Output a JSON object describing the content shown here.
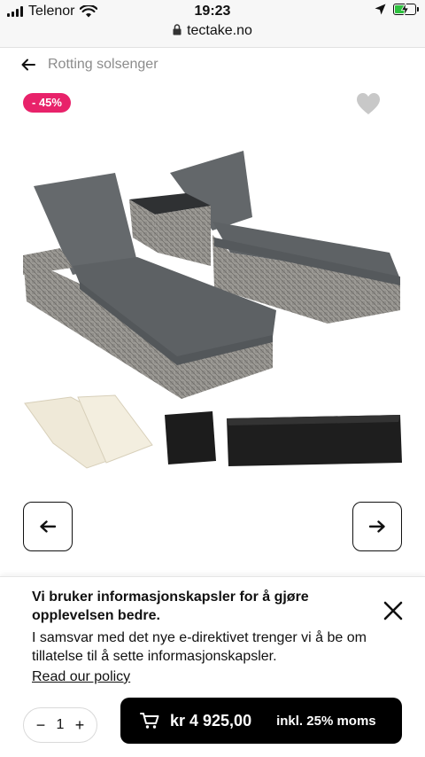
{
  "status_bar": {
    "carrier": "Telenor",
    "time": "19:23",
    "url": "tectake.no"
  },
  "breadcrumb": {
    "label": "Rotting solsenger"
  },
  "product": {
    "discount_badge": "- 45%"
  },
  "cookie_banner": {
    "title": "Vi bruker informasjonskapsler for å gjøre opplevelsen bedre.",
    "text": "I samsvar med det nye e-direktivet trenger vi å be om tillatelse til å sette informasjonskapsler.",
    "link": "Read our policy"
  },
  "purchase": {
    "quantity": "1",
    "minus": "−",
    "plus": "+",
    "price": "kr 4 925,00",
    "vat_note": "inkl. 25% moms"
  },
  "colors": {
    "badge": "#e8226a",
    "cushion": "#5f6264",
    "rattan": "#8c8a86",
    "cart_button": "#000000"
  }
}
